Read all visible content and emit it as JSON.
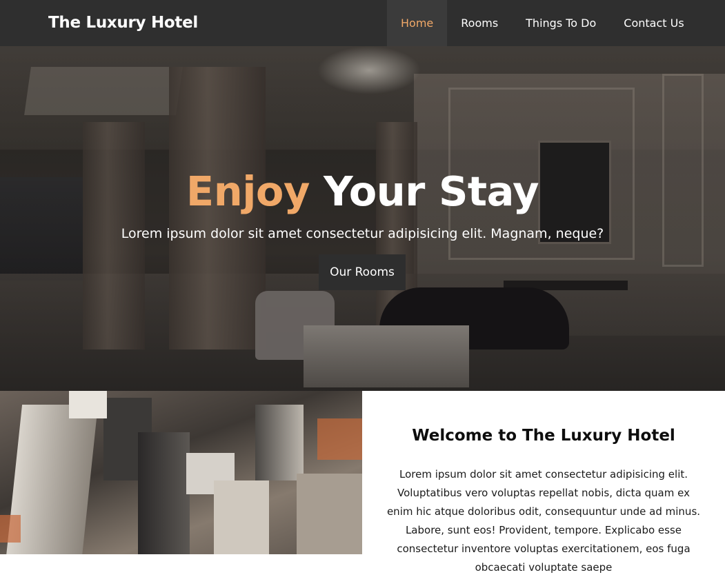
{
  "nav": {
    "brand": "The Luxury Hotel",
    "items": [
      {
        "label": "Home",
        "active": true
      },
      {
        "label": "Rooms",
        "active": false
      },
      {
        "label": "Things To Do",
        "active": false
      },
      {
        "label": "Contact Us",
        "active": false
      }
    ]
  },
  "hero": {
    "title_accent": "Enjoy",
    "title_rest": " Your Stay",
    "subtitle": "Lorem ipsum dolor sit amet consectetur adipisicing elit. Magnam, neque?",
    "button_label": "Our Rooms"
  },
  "welcome": {
    "title": "Welcome to The Luxury Hotel",
    "text": "Lorem ipsum dolor sit amet consectetur adipisicing elit. Voluptatibus vero voluptas repellat nobis, dicta quam ex enim hic atque doloribus odit, consequuntur unde ad minus. Labore, sunt eos! Provident, tempore. Explicabo esse consectetur inventore voluptas exercitationem, eos fuga obcaecati voluptate saepe"
  },
  "colors": {
    "nav_bg": "#2f2f2f",
    "accent": "#f0a868",
    "button_bg": "#2e2e2e"
  }
}
